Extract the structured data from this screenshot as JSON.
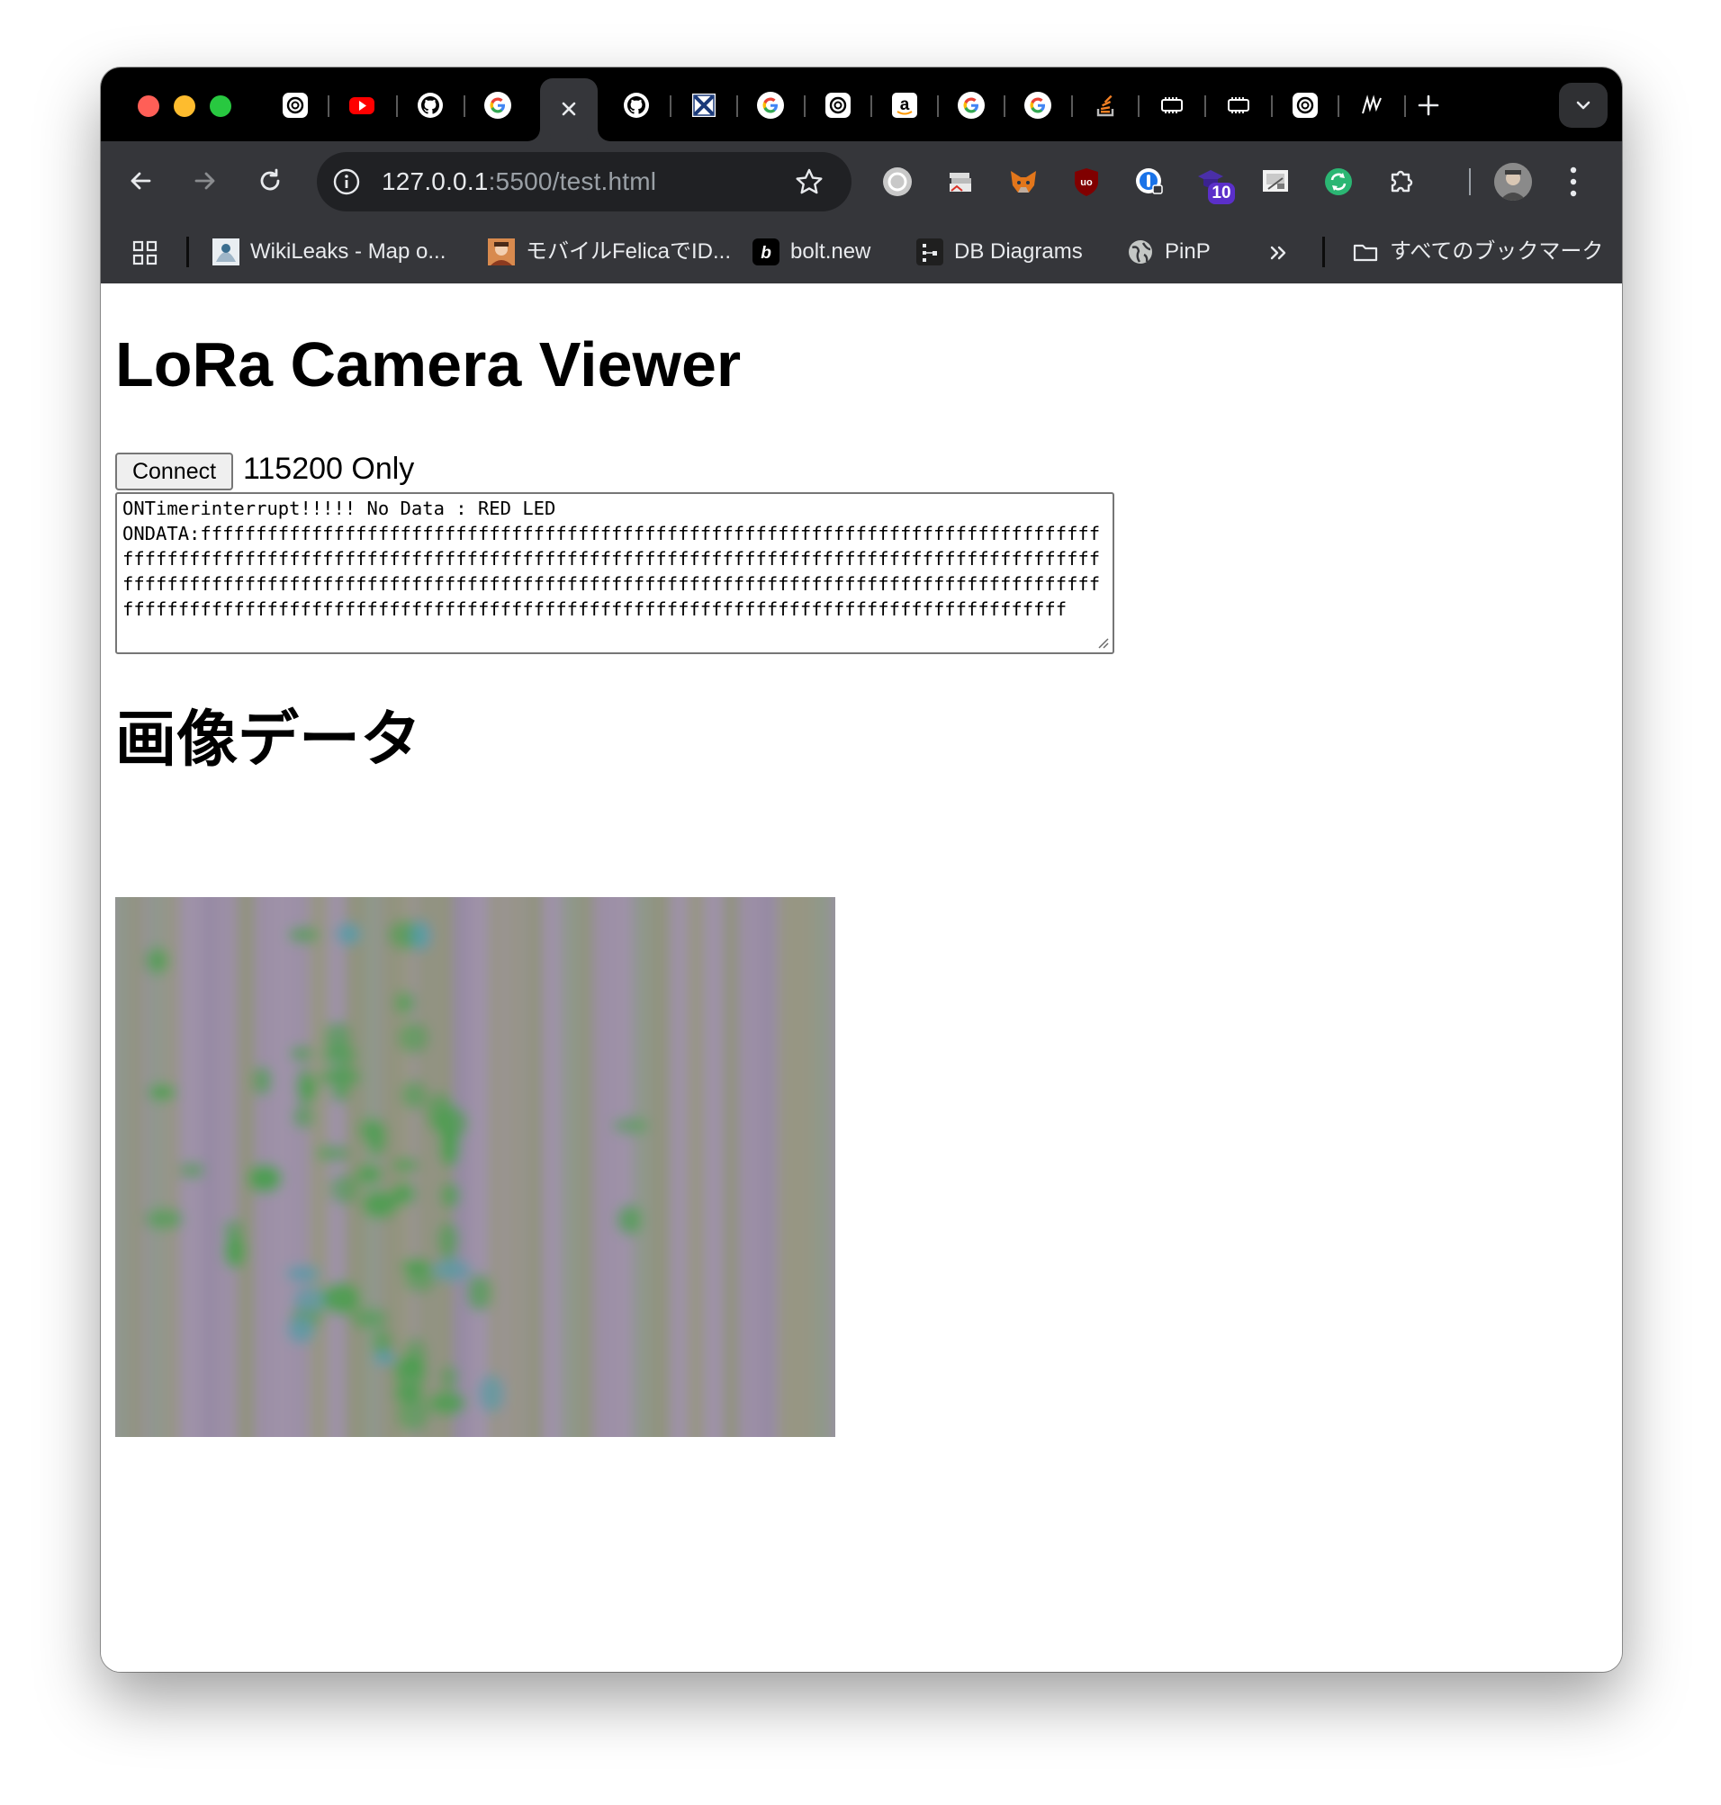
{
  "browser": {
    "tabs": [
      {
        "icon": "chatgpt-icon",
        "active": false
      },
      {
        "icon": "youtube-icon",
        "active": false
      },
      {
        "icon": "github-icon",
        "active": false
      },
      {
        "icon": "google-icon",
        "active": false
      },
      {
        "icon": "close-icon",
        "active": true
      },
      {
        "icon": "github-icon",
        "active": false
      },
      {
        "icon": "x-logo-icon",
        "active": false
      },
      {
        "icon": "google-icon",
        "active": false
      },
      {
        "icon": "chatgpt-icon",
        "active": false
      },
      {
        "icon": "amazon-icon",
        "active": false
      },
      {
        "icon": "google-icon",
        "active": false
      },
      {
        "icon": "google-icon",
        "active": false
      },
      {
        "icon": "stackoverflow-icon",
        "active": false
      },
      {
        "icon": "chip-icon",
        "active": false
      },
      {
        "icon": "chip-icon",
        "active": false
      },
      {
        "icon": "chatgpt-icon",
        "active": false
      },
      {
        "icon": "m-logo-icon",
        "active": false
      }
    ],
    "url_host": "127.0.0.1",
    "url_path": ":5500/test.html",
    "extensions": [
      "grammar-icon",
      "stack-icon",
      "metamask-icon",
      "ublock-icon",
      "password-icon",
      "graduation-icon",
      "screenshot-icon",
      "sync-icon",
      "puzzle-icon"
    ],
    "extension_badge": "10",
    "bookmarks": [
      {
        "label": "WikiLeaks - Map o...",
        "icon": "wikileaks-icon"
      },
      {
        "label": "モバイルFelicaでID...",
        "icon": "person-avatar-icon"
      },
      {
        "label": "bolt.new",
        "icon": "bolt-icon"
      },
      {
        "label": "DB Diagrams",
        "icon": "db-diagram-icon"
      },
      {
        "label": "PinP",
        "icon": "globe-icon"
      }
    ],
    "all_bookmarks_label": "すべてのブックマーク"
  },
  "page": {
    "title": "LoRa Camera Viewer",
    "connect_label": "Connect",
    "baud_note": "115200 Only",
    "log_text": "ONTimerinterrupt!!!!! No Data : RED LED\nONDATA:ffffffffffffffffffffffffffffffffffffffffffffffffffffffffffffffffffffffffffffffffffffffffffffffffffffffffffffffffffffffffffffffffffffffffffffffffffffffffffffffffffffffffffffffffffffffffffffffffffffffffffffffffffffffffffffffffffffffffffffffffffffffffffffffffffffffffffffffffffffffffffffffffffffffffffffffffffffffffffffffffffffffffffffffffffffff",
    "image_heading": "画像データ"
  },
  "colors": {
    "tab_strip_bg": "#000000",
    "toolbar_bg": "#35363a",
    "omnibox_bg": "#202124",
    "image_base_purple": "#9c8fa6",
    "image_accent_green": "#4a9e4e",
    "image_base_olive": "#8f9477"
  }
}
